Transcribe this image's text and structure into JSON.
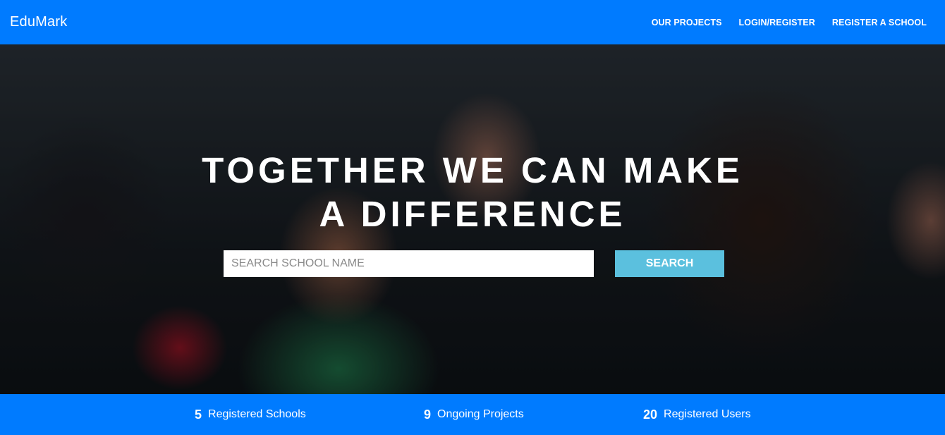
{
  "navbar": {
    "brand": "EduMark",
    "links": [
      "OUR PROJECTS",
      "LOGIN/REGISTER",
      "REGISTER A SCHOOL"
    ]
  },
  "hero": {
    "title_line1": "TOGETHER WE CAN MAKE",
    "title_line2": "A DIFFERENCE",
    "search": {
      "placeholder": "SEARCH SCHOOL NAME",
      "value": "",
      "button_label": "SEARCH"
    }
  },
  "stats": [
    {
      "value": "5",
      "label": "Registered Schools"
    },
    {
      "value": "9",
      "label": "Ongoing Projects"
    },
    {
      "value": "20",
      "label": "Registered Users"
    }
  ],
  "colors": {
    "primary": "#007bff",
    "search_button": "#5bc0de"
  }
}
